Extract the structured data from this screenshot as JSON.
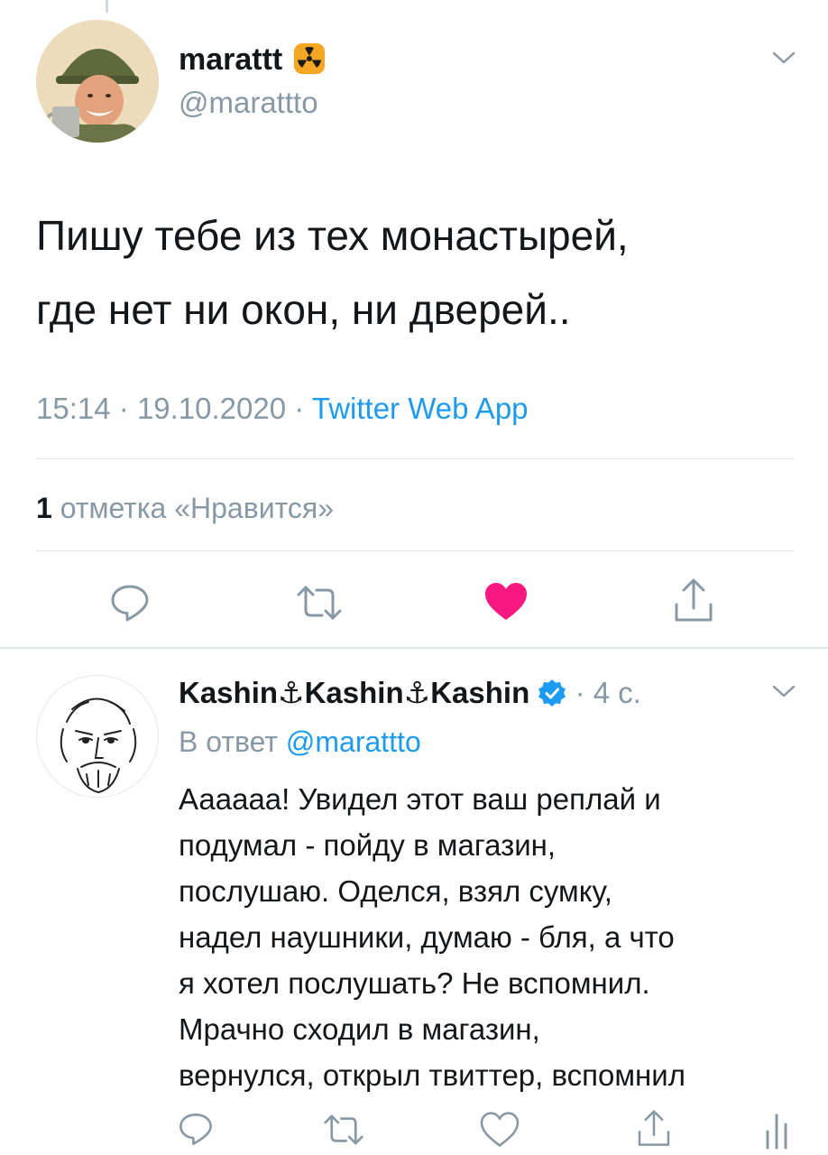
{
  "tweet": {
    "display_name": "marattt",
    "handle": "@marattto",
    "text_line1": "Пишу тебе из тех монастырей,",
    "text_line2": "где нет ни окон, ни дверей..",
    "time": "15:14",
    "date": "19.10.2020",
    "separator": "·",
    "source": "Twitter Web App",
    "likes_count": "1",
    "likes_label": "отметка «Нравится»",
    "liked": true
  },
  "reply": {
    "display_name": "Kashin⚓Kashin⚓Kashin",
    "verified": true,
    "separator": "·",
    "age": "4 с.",
    "reply_prefix": "В ответ",
    "reply_to": "@marattto",
    "text_lines": [
      "Аааааа! Увидел этот ваш реплай и",
      "подумал - пойду в магазин,",
      "послушаю. Оделся, взял сумку,",
      "надел наушники, думаю - бля, а что",
      "я хотел послушать? Не вспомнил.",
      "Мрачно сходил в магазин,",
      "вернулся, открыл твиттер, вспомнил"
    ]
  },
  "colors": {
    "accent": "#1d9bf0",
    "like": "#f91880",
    "muted": "#8899a6",
    "text": "#14171a"
  }
}
